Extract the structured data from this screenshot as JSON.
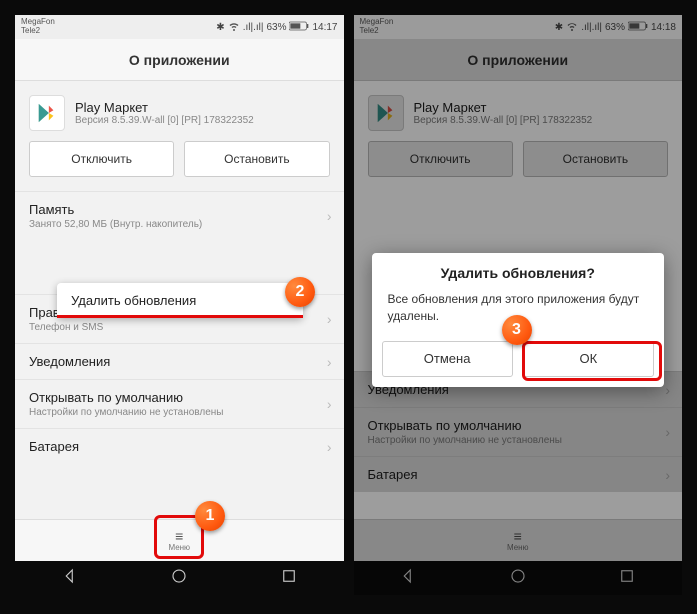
{
  "status": {
    "carrier1": "MegaFon",
    "carrier2": "Tele2",
    "battery": "63%",
    "time": "14:17",
    "time2": "14:18"
  },
  "header": {
    "title": "О приложении"
  },
  "app": {
    "name": "Play Маркет",
    "version": "Версия 8.5.39.W-all [0] [PR] 178322352"
  },
  "buttons": {
    "disable": "Отключить",
    "stop": "Остановить"
  },
  "sections": {
    "memory_title": "Память",
    "memory_sub": "Занято 52,80 МБ (Внутр. накопитель)",
    "rights_title": "Права",
    "rights_sub": "Телефон и SMS",
    "notif_title": "Уведомления",
    "default_title": "Открывать по умолчанию",
    "default_sub": "Настройки по умолчанию не установлены",
    "battery_title": "Батарея"
  },
  "popup": {
    "delete_updates": "Удалить обновления"
  },
  "menu": {
    "label": "Меню"
  },
  "dialog": {
    "title": "Удалить обновления?",
    "message": "Все обновления для этого приложения будут удалены.",
    "cancel": "Отмена",
    "ok": "ОК"
  },
  "markers": {
    "m1": "1",
    "m2": "2",
    "m3": "3"
  }
}
